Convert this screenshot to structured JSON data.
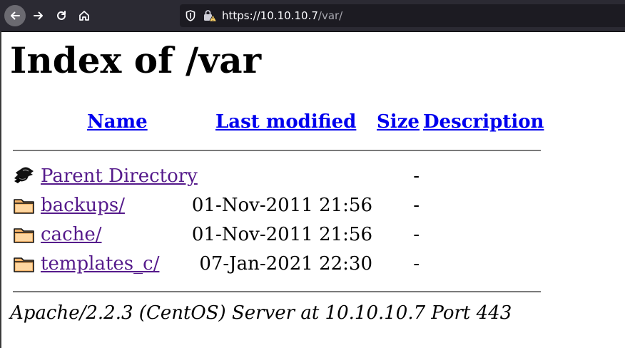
{
  "browser": {
    "url_host": "https://10.10.10.7",
    "url_path": "/var/"
  },
  "page": {
    "title": "Index of /var",
    "columns": {
      "name": "Name",
      "modified": "Last modified",
      "size": "Size",
      "description": "Description"
    },
    "rows": [
      {
        "name": "Parent Directory",
        "modified": "",
        "size": "-",
        "icon": "back-icon"
      },
      {
        "name": "backups/",
        "modified": "01-Nov-2011 21:56",
        "size": "-",
        "icon": "folder-icon"
      },
      {
        "name": "cache/",
        "modified": "01-Nov-2011 21:56",
        "size": "-",
        "icon": "folder-icon"
      },
      {
        "name": "templates_c/",
        "modified": "07-Jan-2021 22:30",
        "size": "-",
        "icon": "folder-icon"
      }
    ],
    "footer": "Apache/2.2.3 (CentOS) Server at 10.10.10.7 Port 443"
  },
  "colors": {
    "link": "#0000ee",
    "visited_link": "#551a8b",
    "toolbar_bg": "#2b2a33"
  }
}
